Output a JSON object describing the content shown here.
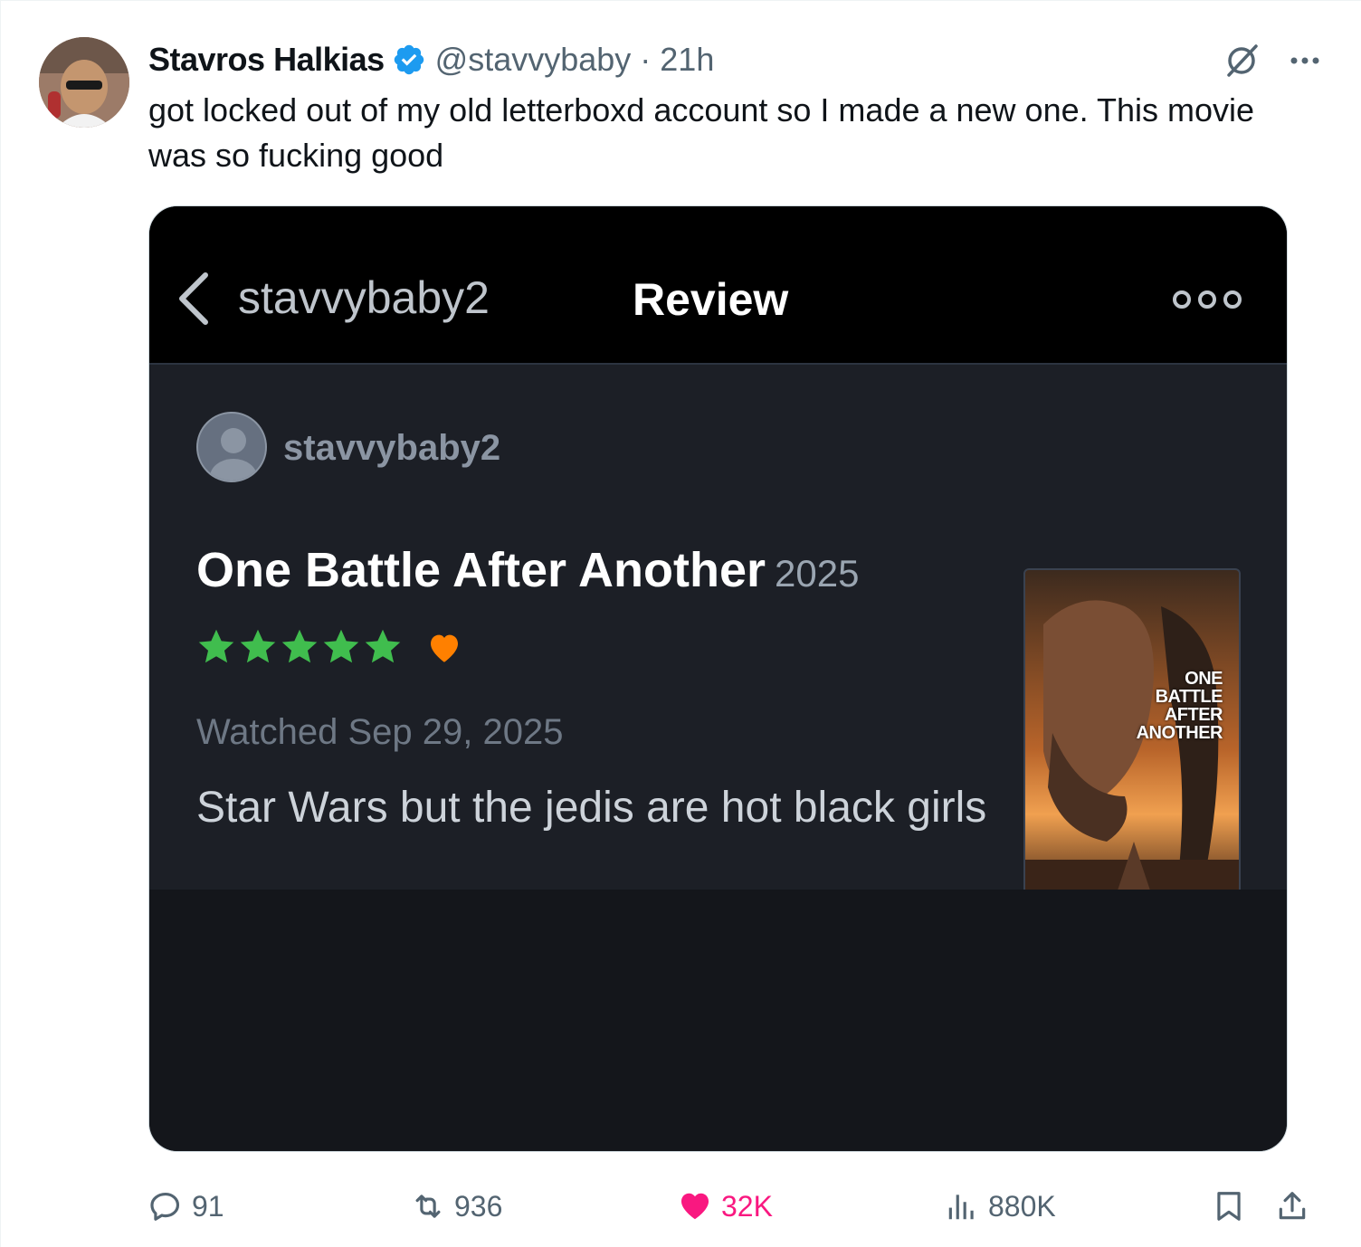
{
  "tweet": {
    "author_name": "Stavros Halkias",
    "handle_time": "@stavvybaby · 21h",
    "text": "got locked out of my old letterboxd account so I made a new one. This movie was so fucking good",
    "stats": {
      "replies": "91",
      "reposts": "936",
      "likes": "32K",
      "views": "880K"
    },
    "colors": {
      "verified": "#1d9bf0",
      "like": "#f91880",
      "secondary": "#536471"
    }
  },
  "letterboxd": {
    "nav_username": "stavvybaby2",
    "page_title": "Review",
    "reviewer": "stavvybaby2",
    "film_title": "One Battle After Another",
    "film_year": "2025",
    "rating_stars": 5,
    "liked": true,
    "watched": "Watched Sep 29, 2025",
    "review_text": "Star Wars but the jedis are hot black girls",
    "poster_title": "ONE\nBATTLE\nAFTER\nANOTHER",
    "colors": {
      "star": "#40bd4e",
      "heart": "#ff8000",
      "background": "#1c1f26"
    }
  }
}
